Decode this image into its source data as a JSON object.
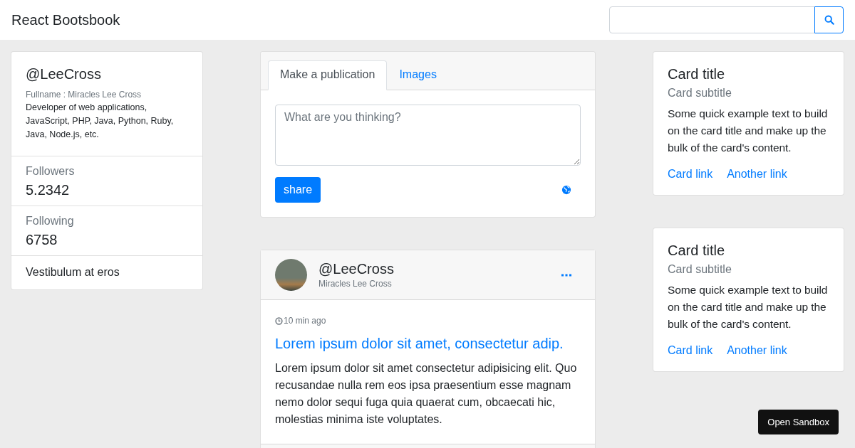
{
  "navbar": {
    "brand": "React Bootsbook"
  },
  "profile": {
    "handle": "@LeeCross",
    "fullname": "Fullname : Miracles Lee Cross",
    "bio": "Developer of web applications, JavaScript, PHP, Java, Python, Ruby, Java, Node.js, etc.",
    "stats": [
      {
        "label": "Followers",
        "value": "5.2342"
      },
      {
        "label": "Following",
        "value": "6758"
      }
    ],
    "footer": "Vestibulum at eros"
  },
  "composer": {
    "tabs": [
      {
        "label": "Make a publication",
        "selected": true
      },
      {
        "label": "Images",
        "selected": false
      }
    ],
    "placeholder": "What are you thinking?",
    "button": "share"
  },
  "post": {
    "handle": "@LeeCross",
    "name": "Miracles Lee Cross",
    "time": "10 min ago",
    "title": "Lorem ipsum dolor sit amet, consectetur adip.",
    "body": "Lorem ipsum dolor sit amet consectetur adipisicing elit. Quo recusandae nulla rem eos ipsa praesentium esse magnam nemo dolor sequi fuga quia quaerat cum, obcaecati hic, molestias minima iste voluptates."
  },
  "cards": [
    {
      "title": "Card title",
      "subtitle": "Card subtitle",
      "text": "Some quick example text to build on the card title and make up the bulk of the card's content.",
      "links": [
        "Card link",
        "Another link"
      ]
    },
    {
      "title": "Card title",
      "subtitle": "Card subtitle",
      "text": "Some quick example text to build on the card title and make up the bulk of the card's content.",
      "links": [
        "Card link",
        "Another link"
      ]
    }
  ],
  "sandbox_button": "Open Sandbox"
}
